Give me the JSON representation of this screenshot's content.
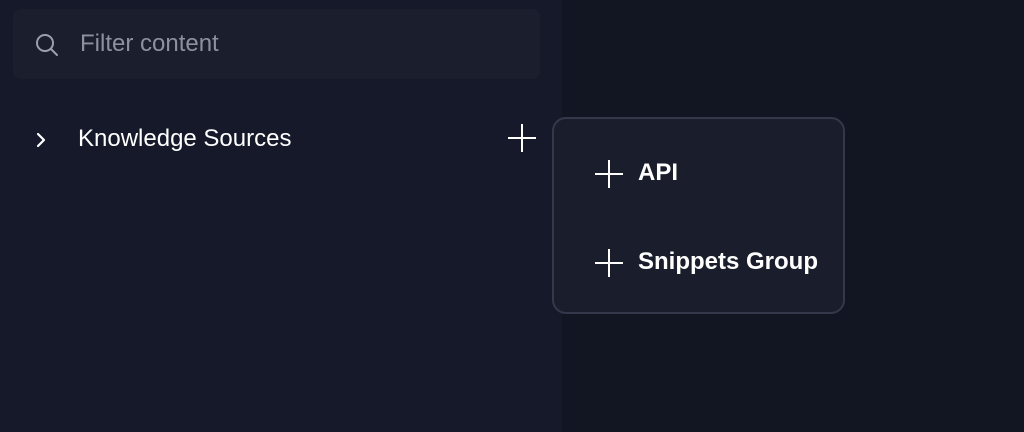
{
  "search": {
    "placeholder": "Filter content",
    "value": "",
    "icon": "search-icon"
  },
  "tree": {
    "items": [
      {
        "label": "Knowledge Sources",
        "expanded": false,
        "icon": "chevron-right-icon",
        "action_icon": "plus-icon"
      }
    ]
  },
  "menu": {
    "items": [
      {
        "label": "API",
        "icon": "plus-icon"
      },
      {
        "label": "Snippets Group",
        "icon": "plus-icon"
      }
    ]
  },
  "colors": {
    "sidebar_bg": "#151929",
    "main_bg": "#121522",
    "search_bg": "#1a1e2d",
    "menu_bg": "#1a1d2b",
    "menu_border": "#34384a",
    "text": "#ffffff",
    "placeholder": "#8c91a0"
  }
}
